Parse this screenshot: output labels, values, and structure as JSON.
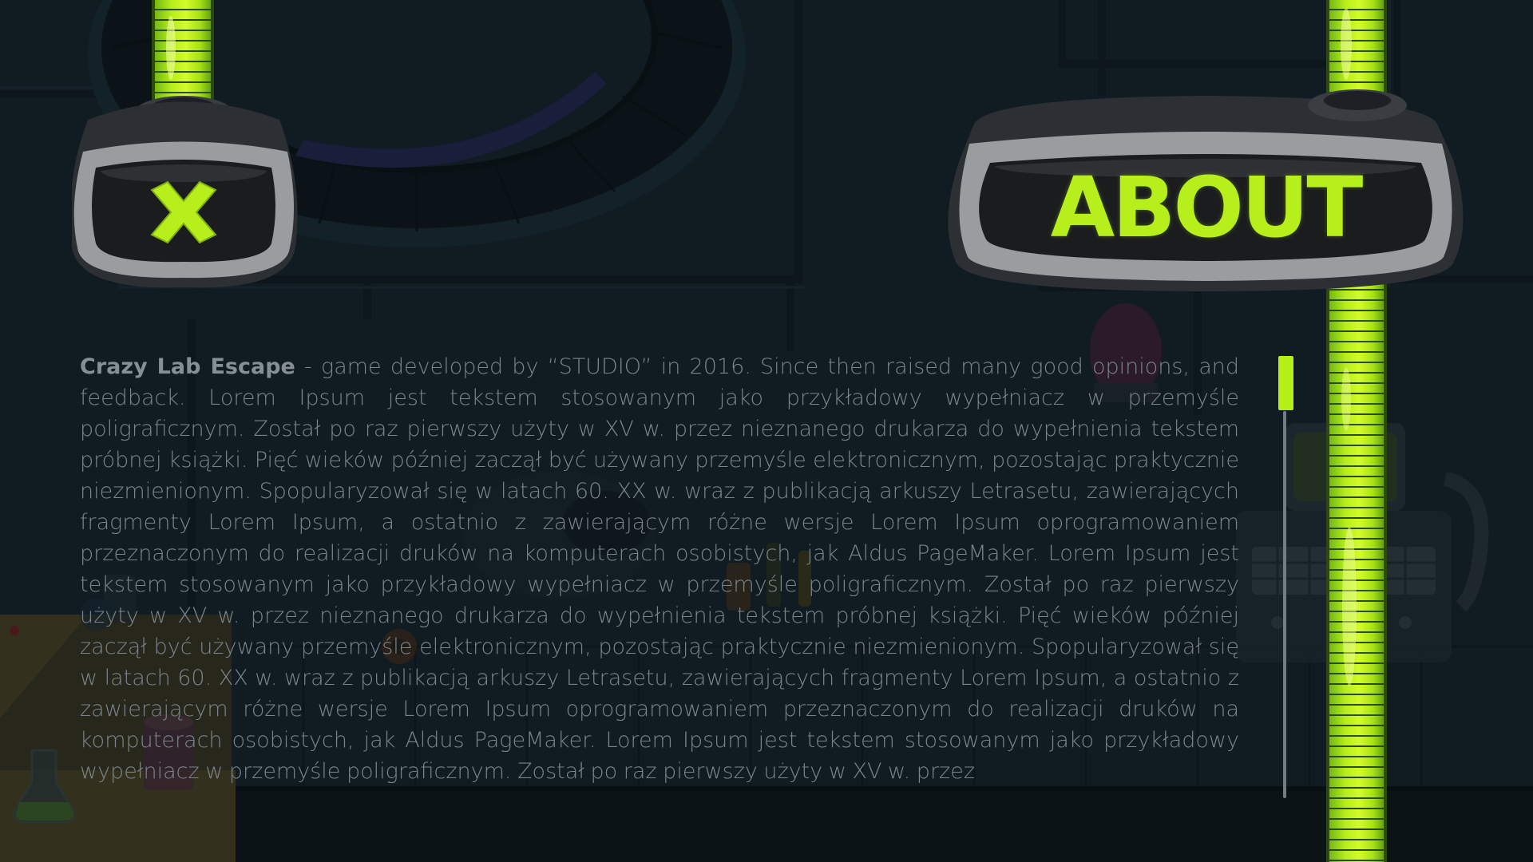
{
  "screen": {
    "title": "ABOUT",
    "close_icon": "close-x-icon",
    "accent_color": "#b7ef1c"
  },
  "about": {
    "game_name": "Crazy Lab Escape",
    "body": " - game developed by “STUDIO” in 2016. Since then raised many good opinions, and feedback. Lorem Ipsum jest tekstem stosowanym jako przykładowy wypełniacz w przemyśle poligraficznym. Został po raz pierwszy użyty w XV w. przez nieznanego drukarza do wypełnienia tekstem próbnej książki. Pięć wieków później zaczął być używany przemyśle elektronicznym, pozostając praktycznie niezmienionym. Spopularyzował się w latach 60. XX w. wraz z publikacją arkuszy Letrasetu, zawierających fragmenty Lorem Ipsum, a ostatnio z zawierającym różne wersje Lorem Ipsum oprogramowaniem przeznaczonym do realizacji druków na komputerach osobistych, jak Aldus PageMaker. Lorem Ipsum jest tekstem stosowanym jako przykładowy wypełniacz w przemyśle poligraficznym. Został po raz pierwszy użyty w XV w. przez nieznanego drukarza do wypełnienia tekstem próbnej książki. Pięć wieków później zaczął być używany przemyśle elektronicznym, pozostając praktycznie niezmienionym. Spopularyzował się w latach 60. XX w. wraz z publikacją arkuszy Letrasetu, zawierających fragmenty Lorem Ipsum, a ostatnio z zawierającym różne wersje Lorem Ipsum oprogramowaniem przeznaczonym do realizacji druków na komputerach osobistych, jak Aldus PageMaker. Lorem Ipsum jest tekstem stosowanym jako przykładowy wypełniacz w przemyśle poligraficznym. Został po raz pierwszy użyty w XV w. przez"
  },
  "scrollbar": {
    "position": 0
  }
}
